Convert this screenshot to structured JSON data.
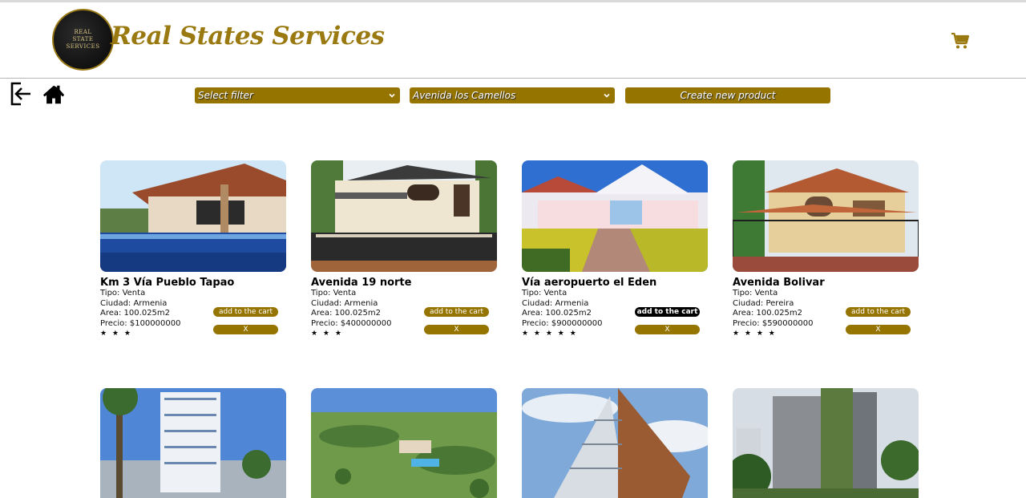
{
  "header": {
    "logo_text": "REAL\nSTATE\nSERVICES",
    "brand": "Real States Services"
  },
  "toolbar": {
    "filter_select": "Select filter",
    "location_select": "Avenida los Camellos",
    "create_button": "Create new product"
  },
  "products": [
    {
      "title": "Km 3 Vía Pueblo Tapao",
      "tipo": "Tipo: Venta",
      "ciudad": "Ciudad: Armenia",
      "area": "Area: 100.025m2",
      "precio": "Precio: $100000000",
      "stars": "★ ★ ★",
      "add_label": "add to the cart",
      "remove_label": "X"
    },
    {
      "title": "Avenida 19 norte",
      "tipo": "Tipo: Venta",
      "ciudad": "Ciudad: Armenia",
      "area": "Area: 100.025m2",
      "precio": "Precio: $400000000",
      "stars": "★ ★ ★",
      "add_label": "add to the cart",
      "remove_label": "X"
    },
    {
      "title": "Vía aeropuerto el Eden",
      "tipo": "Tipo: Venta",
      "ciudad": "Ciudad: Armenia",
      "area": "Area: 100.025m2",
      "precio": "Precio: $900000000",
      "stars": "★ ★ ★ ★ ★",
      "add_label": "add to the cart",
      "remove_label": "X"
    },
    {
      "title": "Avenida Bolivar",
      "tipo": "Tipo: Venta",
      "ciudad": "Ciudad: Pereira",
      "area": "Area: 100.025m2",
      "precio": "Precio: $590000000",
      "stars": "★ ★ ★ ★",
      "add_label": "add to the cart",
      "remove_label": "X"
    }
  ],
  "colors": {
    "accent": "#967400",
    "brand_text": "#9a7a10"
  }
}
